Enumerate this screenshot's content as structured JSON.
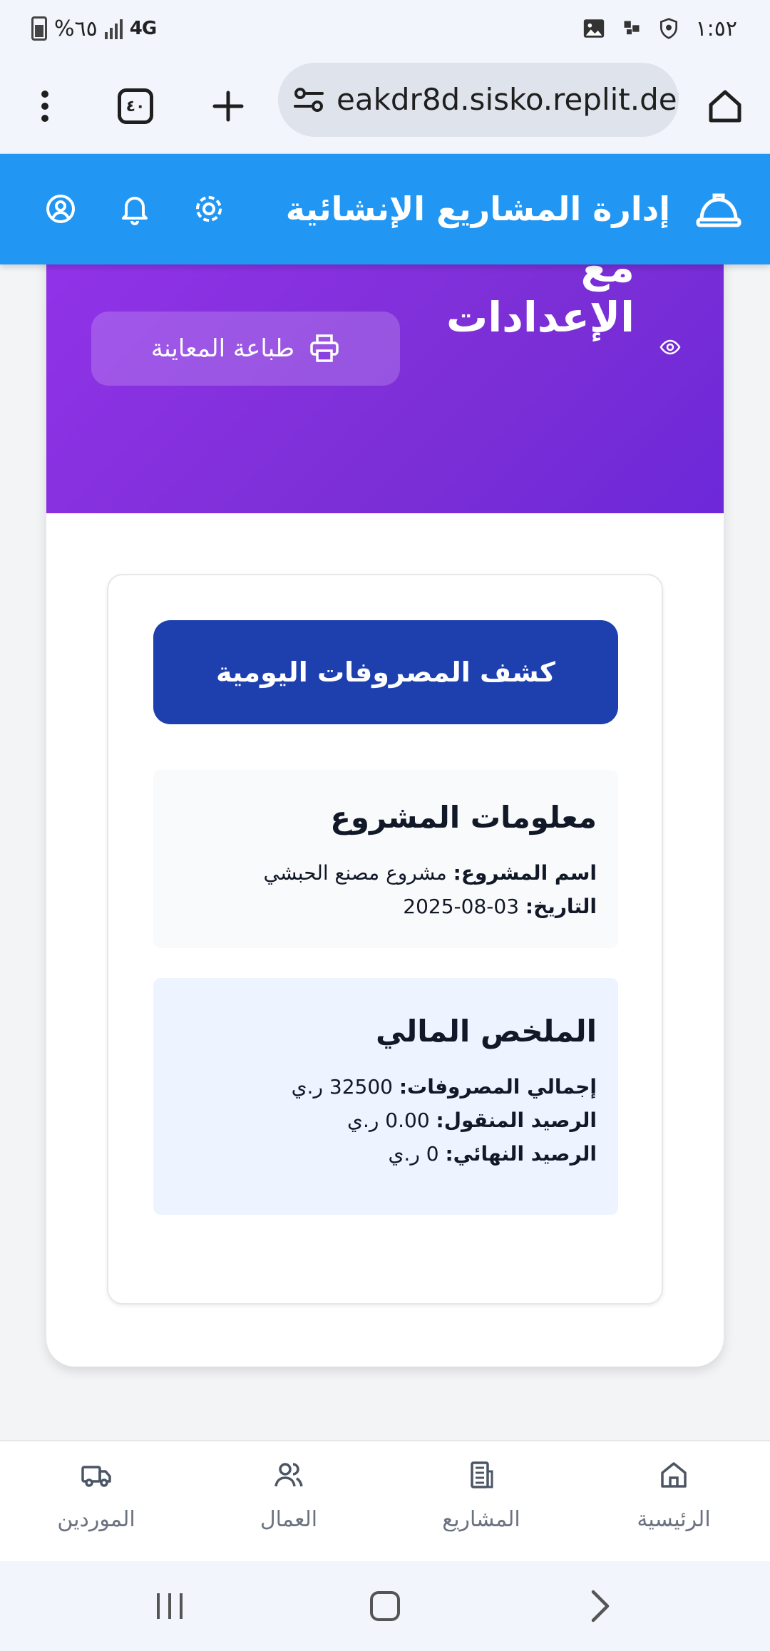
{
  "status_bar": {
    "time": "١:٥٢",
    "battery": "%٦٥",
    "network": "4G"
  },
  "browser": {
    "url": "eakdr8d.sisko.replit.dev",
    "tab_count": "٤٠"
  },
  "header": {
    "title": "إدارة المشاريع الإنشائية"
  },
  "banner": {
    "title": "المعاينة المباشرة مع الإعدادات",
    "print_label": "طباعة المعاينة"
  },
  "report": {
    "button_label": "كشف المصروفات اليومية",
    "project_info": {
      "title": "معلومات المشروع",
      "name_label": "اسم المشروع:",
      "name_value": "مشروع مصنع الحبشي",
      "date_label": "التاريخ:",
      "date_value": "03-08-2025"
    },
    "financial": {
      "title": "الملخص المالي",
      "total_label": "إجمالي المصروفات:",
      "total_value": "32500 ر.ي",
      "carried_label": "الرصيد المنقول:",
      "carried_value": "0.00 ر.ي",
      "final_label": "الرصيد النهائي:",
      "final_value": "0 ر.ي"
    }
  },
  "bottom_nav": {
    "home": "الرئيسية",
    "projects": "المشاريع",
    "workers": "العمال",
    "suppliers": "الموردين"
  },
  "colors": {
    "header": "#2196f3",
    "banner": "#9333ea",
    "primary_button": "#1e40af"
  }
}
